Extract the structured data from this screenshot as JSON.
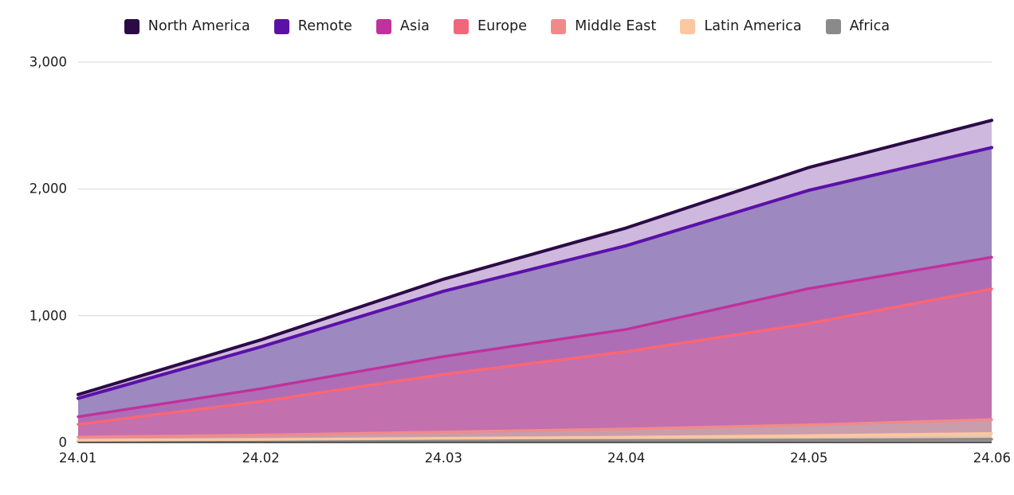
{
  "chart_data": {
    "type": "area",
    "stacked": true,
    "title": "",
    "subtitle": "",
    "xlabel": "",
    "ylabel": "",
    "categories": [
      "24.01",
      "24.02",
      "24.03",
      "24.04",
      "24.05",
      "24.06"
    ],
    "x_tick_labels": [
      "24.01",
      "24.02",
      "24.03",
      "24.04",
      "24.05",
      "24.06"
    ],
    "y_tick_labels": [
      "0",
      "1,000",
      "2,000",
      "3,000"
    ],
    "y_tick_values": [
      0,
      1000,
      2000,
      3000
    ],
    "ylim": [
      0,
      3000
    ],
    "grid": "horizontal",
    "legend_position": "top-center",
    "series": [
      {
        "name": "North America",
        "color": "#2b0b45",
        "fill": "#cdb6dd",
        "values": [
          30,
          55,
          95,
          140,
          180,
          215
        ]
      },
      {
        "name": "Remote",
        "color": "#5b11a8",
        "fill": "#9b84be",
        "values": [
          145,
          330,
          515,
          660,
          775,
          865
        ]
      },
      {
        "name": "Asia",
        "color": "#c0319c",
        "fill": "#ab69b4",
        "values": [
          60,
          100,
          140,
          175,
          275,
          250
        ]
      },
      {
        "name": "Europe",
        "color": "#fc6673",
        "fill": "#c06bab",
        "values": [
          100,
          265,
          455,
          610,
          800,
          1030
        ]
      },
      {
        "name": "Middle East",
        "color": "#f08a8a",
        "fill": "#c79aa8",
        "values": [
          25,
          35,
          50,
          65,
          85,
          110
        ]
      },
      {
        "name": "Latin America",
        "color": "#fac7a0",
        "fill": "#e7c3ae",
        "values": [
          10,
          14,
          20,
          26,
          34,
          45
        ]
      },
      {
        "name": "Africa",
        "color": "#8a8a8a",
        "fill": "#9b9097",
        "values": [
          8,
          10,
          13,
          16,
          20,
          26
        ]
      }
    ]
  },
  "legend": {
    "items": [
      {
        "label": "North America",
        "color": "#2b0b45"
      },
      {
        "label": "Remote",
        "color": "#5b11a8"
      },
      {
        "label": "Asia",
        "color": "#c0319c"
      },
      {
        "label": "Europe",
        "color": "#f2667c"
      },
      {
        "label": "Middle East",
        "color": "#f08a8a"
      },
      {
        "label": "Latin America",
        "color": "#fac7a0"
      },
      {
        "label": "Africa",
        "color": "#8a8a8a"
      }
    ]
  }
}
